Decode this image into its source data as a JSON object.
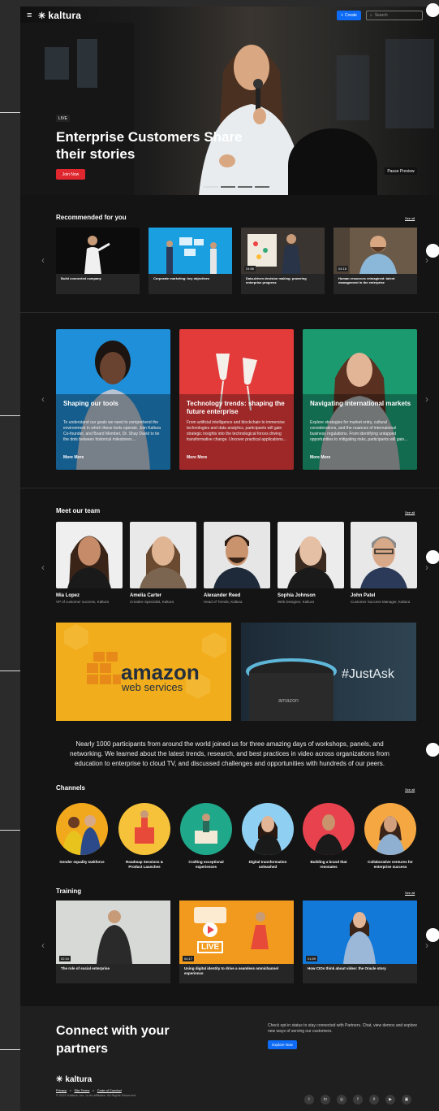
{
  "nav": {
    "brand": "kaltura",
    "create_label": "Create",
    "search_placeholder": "Search",
    "menu_icon": "hamburger-icon"
  },
  "hero": {
    "badge": "LIVE",
    "title": "Enterprise Customers Share their stories",
    "join_label": "Join Now",
    "pause_label": "Pause Preview"
  },
  "recommended": {
    "title": "Recommended for you",
    "see_all": "See all",
    "items": [
      {
        "caption": "Build connected company",
        "duration": ""
      },
      {
        "caption": "Corporate marketing: key objectives",
        "duration": ""
      },
      {
        "caption": "Data-driven decision making: powering enterprise progress",
        "duration": "24:56"
      },
      {
        "caption": "Human resources reimagined: talent management in the enterprise",
        "duration": "04:16"
      }
    ]
  },
  "promos": [
    {
      "title": "Shaping our tools",
      "desc": "To understand our goals we need to comprehend the environment in which these tools operate. Join Kaltura Co-founder, and Board Member, Dr. Shay David to tie the dots between historical milestones ...",
      "more": "More More",
      "color": "#1f8fd9"
    },
    {
      "title": "Technology trends: shaping the future enterprise",
      "desc": "From artificial intelligence and blockchain to immersive technologies and data analytics, participants will gain strategic insights into the technological forces driving transformative change. Uncover practical applications...",
      "more": "More More",
      "color": "#e33a3a"
    },
    {
      "title": "Navigating international markets",
      "desc": "Explore strategies for market entry, cultural considerations, and the nuances of international business regulations. From identifying untapped opportunities to mitigating risks, participants will gain...",
      "more": "More More",
      "color": "#1b9a70"
    }
  ],
  "team": {
    "title": "Meet our team",
    "see_all": "See all",
    "members": [
      {
        "name": "Mia Lopez",
        "role": "VP of customer success, Kaltura"
      },
      {
        "name": "Amelia Carter",
        "role": "Creative Specialist, Kaltura"
      },
      {
        "name": "Alexander Reed",
        "role": "Head of Trends, Kaltura"
      },
      {
        "name": "Sophia Johnson",
        "role": "Web Designer, Kaltura"
      },
      {
        "name": "John Patel",
        "role": "Customer Success Manager, Kaltura"
      }
    ]
  },
  "banners": {
    "aws_line1": "amazon",
    "aws_line2": "web services",
    "echo_tag": "#JustAsk",
    "echo_brand": "amazon"
  },
  "description": "Nearly 1000 participants from around the world joined us for three amazing days of workshops, panels, and networking. We learned about the latest trends, research, and best practices in video across organizations from education to enterprise to cloud TV, and discussed challenges and opportunities with hundreds of our peers.",
  "channels": {
    "title": "Channels",
    "see_all": "See all",
    "items": [
      {
        "name": "Gender equality taskforce",
        "color": "#f2a81d"
      },
      {
        "name": "Roadmap Sessions & Product Launches",
        "color": "#f5c23a"
      },
      {
        "name": "Crafting exceptional experiences",
        "color": "#1fa88a"
      },
      {
        "name": "Digital transformation unleashed",
        "color": "#8fd0f2"
      },
      {
        "name": "Building a brand that resonates",
        "color": "#e8424e"
      },
      {
        "name": "Collaborative ventures for enterprise success",
        "color": "#f5a742"
      }
    ]
  },
  "training": {
    "title": "Training",
    "see_all": "See all",
    "items": [
      {
        "caption": "The role of social enterprise",
        "duration": "02:34"
      },
      {
        "caption": "Using digital identity to drive a seamless omnichannel experience",
        "duration": "04:17",
        "overlay": "LIVE"
      },
      {
        "caption": "How CIOs think about video: the Oracle story",
        "duration": "01:59"
      }
    ]
  },
  "footer": {
    "title": "Connect with your partners",
    "text": "Check opt-in status to stay connected with Partners. Chat, view demos and explore new ways of serving our customers.",
    "explore_label": "Explore Now",
    "brand": "kaltura",
    "links": [
      "Privacy",
      "Site Terms",
      "Code of Conduct"
    ],
    "copyright": "© 2021 Kaltura, Inc. or its affiliates. All Rights Reserved",
    "socials": [
      "twitter-icon",
      "linkedin-icon",
      "instagram-icon",
      "facebook-icon",
      "slack-icon",
      "youtube-icon",
      "twitch-icon"
    ]
  }
}
